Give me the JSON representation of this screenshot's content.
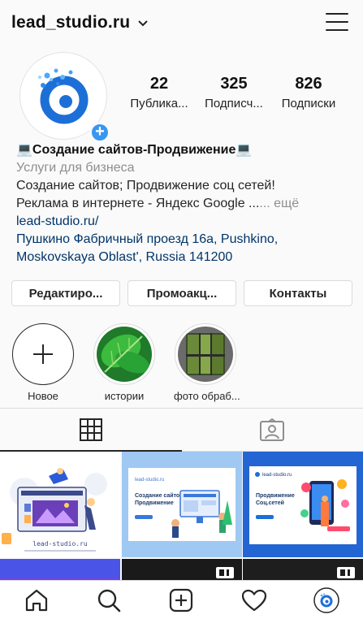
{
  "header": {
    "username": "lead_studio.ru"
  },
  "stats": [
    {
      "value": "22",
      "label": "Публика..."
    },
    {
      "value": "325",
      "label": "Подписч..."
    },
    {
      "value": "826",
      "label": "Подписки"
    }
  ],
  "bio": {
    "name": "💻Создание сайтов-Продвижение💻",
    "category": "Услуги для бизнеса",
    "line1": "Создание сайтов; Продвижение соц сетей!",
    "line2": "Реклама в интернете - Яндекс Google ...",
    "more": "... ещё",
    "website": "lead-studio.ru/",
    "address1": "Пушкино Фабричный проезд 16а, Pushkino,",
    "address2": "Moskovskaya Oblast', Russia 141200"
  },
  "buttons": {
    "edit": "Редактиро...",
    "promo": "Промоакц...",
    "contacts": "Контакты"
  },
  "highlights": [
    {
      "label": "Новое"
    },
    {
      "label": "истории"
    },
    {
      "label": "фото обраб..."
    }
  ],
  "posts": {
    "p1_caption": "lead-studio.ru",
    "p2_brand": "lead-studio.ru",
    "p2_title": "Создание сайтов Продвижение",
    "p3_brand": "lead-studio.ru",
    "p3_title": "Продвижение Соц.сетей"
  },
  "icons": {
    "menu": "hamburger-icon",
    "grid": "grid-icon",
    "tagged": "tagged-icon",
    "home": "home-icon",
    "search": "search-icon",
    "add": "add-post-icon",
    "activity": "heart-icon",
    "profile": "profile-avatar-icon"
  },
  "colors": {
    "accent": "#3897f0",
    "link": "#003569",
    "muted": "#8e8e8e",
    "text": "#262626"
  }
}
